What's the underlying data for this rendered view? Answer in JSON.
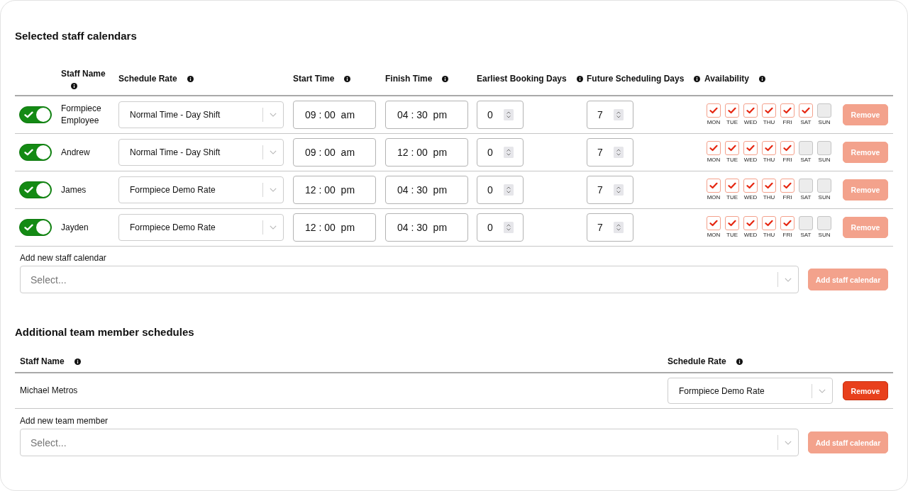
{
  "selected_staff_calendars": {
    "title": "Selected staff calendars",
    "columns": [
      {
        "label": "Staff Name",
        "info": true
      },
      {
        "label": "Schedule Rate",
        "info": true
      },
      {
        "label": "Start Time",
        "info": true
      },
      {
        "label": "Finish Time",
        "info": true
      },
      {
        "label": "Earliest Booking Days",
        "info": true
      },
      {
        "label": "Future Scheduling Days",
        "info": true
      },
      {
        "label": "Availability",
        "info": true
      }
    ],
    "rows": [
      {
        "enabled": true,
        "name": "Formpiece Employee",
        "schedule_rate": "Normal Time - Day Shift",
        "start_time": "09 : 00  am",
        "finish_time": "04 : 30  pm",
        "earliest_booking_days": "0",
        "future_scheduling_days": "7",
        "availability": [
          {
            "day": "MON",
            "checked": true
          },
          {
            "day": "TUE",
            "checked": true
          },
          {
            "day": "WED",
            "checked": true
          },
          {
            "day": "THU",
            "checked": true
          },
          {
            "day": "FRI",
            "checked": true
          },
          {
            "day": "SAT",
            "checked": true
          },
          {
            "day": "SUN",
            "checked": false
          }
        ],
        "remove_button": {
          "label": "Remove",
          "disabled": true
        }
      },
      {
        "enabled": true,
        "name": "Andrew",
        "schedule_rate": "Normal Time - Day Shift",
        "start_time": "09 : 00  am",
        "finish_time": "12 : 00  pm",
        "earliest_booking_days": "0",
        "future_scheduling_days": "7",
        "availability": [
          {
            "day": "MON",
            "checked": true
          },
          {
            "day": "TUE",
            "checked": true
          },
          {
            "day": "WED",
            "checked": true
          },
          {
            "day": "THU",
            "checked": true
          },
          {
            "day": "FRI",
            "checked": true
          },
          {
            "day": "SAT",
            "checked": false
          },
          {
            "day": "SUN",
            "checked": false
          }
        ],
        "remove_button": {
          "label": "Remove",
          "disabled": true
        }
      },
      {
        "enabled": true,
        "name": "James",
        "schedule_rate": "Formpiece Demo Rate",
        "start_time": "12 : 00  pm",
        "finish_time": "04 : 30  pm",
        "earliest_booking_days": "0",
        "future_scheduling_days": "7",
        "availability": [
          {
            "day": "MON",
            "checked": true
          },
          {
            "day": "TUE",
            "checked": true
          },
          {
            "day": "WED",
            "checked": true
          },
          {
            "day": "THU",
            "checked": true
          },
          {
            "day": "FRI",
            "checked": true
          },
          {
            "day": "SAT",
            "checked": false
          },
          {
            "day": "SUN",
            "checked": false
          }
        ],
        "remove_button": {
          "label": "Remove",
          "disabled": true
        }
      },
      {
        "enabled": true,
        "name": "Jayden",
        "schedule_rate": "Formpiece Demo Rate",
        "start_time": "12 : 00  pm",
        "finish_time": "04 : 30  pm",
        "earliest_booking_days": "0",
        "future_scheduling_days": "7",
        "availability": [
          {
            "day": "MON",
            "checked": true
          },
          {
            "day": "TUE",
            "checked": true
          },
          {
            "day": "WED",
            "checked": true
          },
          {
            "day": "THU",
            "checked": true
          },
          {
            "day": "FRI",
            "checked": true
          },
          {
            "day": "SAT",
            "checked": false
          },
          {
            "day": "SUN",
            "checked": false
          }
        ],
        "remove_button": {
          "label": "Remove",
          "disabled": true
        }
      }
    ],
    "add_new": {
      "label": "Add new staff calendar",
      "placeholder": "Select...",
      "button": {
        "label": "Add staff calendar",
        "disabled": true
      }
    }
  },
  "additional_team_member_schedules": {
    "title": "Additional team member schedules",
    "columns": [
      {
        "label": "Staff Name",
        "info": true
      },
      {
        "label": "Schedule Rate",
        "info": true
      }
    ],
    "rows": [
      {
        "name": "Michael Metros",
        "schedule_rate": "Formpiece Demo Rate",
        "remove_button": {
          "label": "Remove",
          "disabled": false
        }
      }
    ],
    "add_new": {
      "label": "Add new team member",
      "placeholder": "Select...",
      "button": {
        "label": "Add staff calendar",
        "disabled": true
      }
    }
  }
}
